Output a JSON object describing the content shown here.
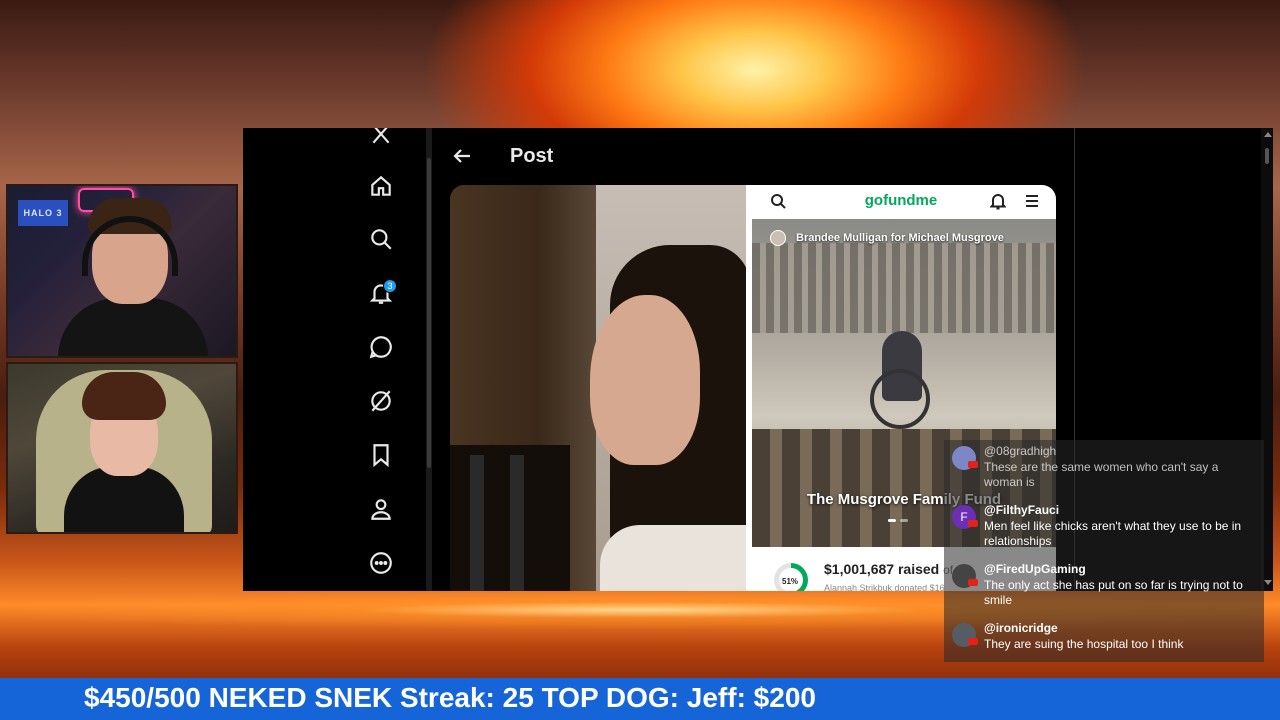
{
  "x_app": {
    "page_title": "Post",
    "notifications_badge": "3",
    "nav": [
      "close-icon",
      "home-icon",
      "search-icon",
      "notifications-icon",
      "messages-icon",
      "grok-icon",
      "bookmarks-icon",
      "profile-icon",
      "more-icon"
    ]
  },
  "gofundme": {
    "logo": "gofundme",
    "organizer": "Brandee Mulligan for Michael Musgrove",
    "campaign_title": "The Musgrove Family Fund",
    "progress_percent": 51,
    "progress_label": "51%",
    "raised_amount": "$1,001,687 raised",
    "raised_suffix": "of",
    "recent_donation": "Alannah Strikbuk donated $16"
  },
  "chat": {
    "messages": [
      {
        "user": "@08gradhigh",
        "text": "These are the same women who can't say a woman is",
        "avatar_letter": "",
        "avatar_color": "#7d87c8"
      },
      {
        "user": "@FilthyFauci",
        "text": "Men feel like chicks aren't what they use to be in relationships",
        "avatar_letter": "F",
        "avatar_color": "#6a2fb5"
      },
      {
        "user": "@FiredUpGaming",
        "text": "The only act she has put on so far is trying not to smile",
        "avatar_letter": "",
        "avatar_color": "#444444"
      },
      {
        "user": "@ironicridge",
        "text": "They are suing the hospital too I think",
        "avatar_letter": "",
        "avatar_color": "#555c66"
      }
    ]
  },
  "ticker": {
    "text": "$450/500 NEKED SNEK Streak: 25 TOP DOG: Jeff: $200"
  },
  "webcam_top": {
    "neon_sign": "HALO 3"
  },
  "colors": {
    "x_accent": "#1d9bf0",
    "gofundme_green": "#02a95c",
    "ticker_blue": "#1565d8"
  }
}
